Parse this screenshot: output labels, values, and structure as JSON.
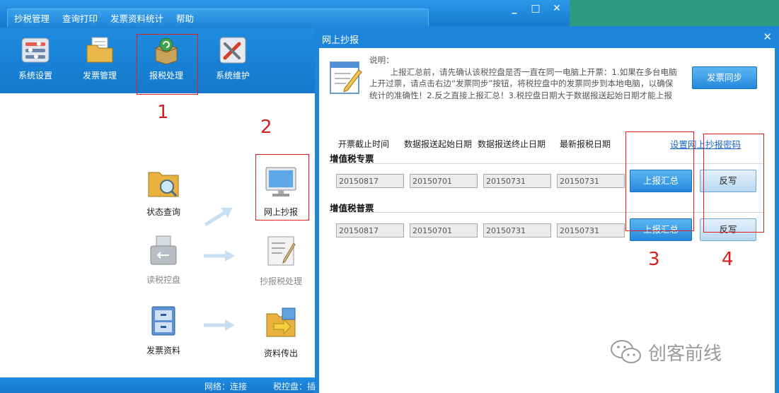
{
  "main_window": {
    "menu": [
      "抄税管理",
      "查询打印",
      "发票资料统计",
      "帮助"
    ],
    "window_buttons": [
      "_",
      "□",
      "✕"
    ],
    "toolbar": [
      {
        "label": "系统设置",
        "icon": "settings-panel-icon"
      },
      {
        "label": "发票管理",
        "icon": "invoice-folder-icon"
      },
      {
        "label": "报税处理",
        "icon": "tax-process-icon"
      },
      {
        "label": "系统维护",
        "icon": "maintenance-tools-icon"
      }
    ],
    "nodes": {
      "status_query": "状态查询",
      "online_copy": "网上抄报",
      "read_disk": "读税控盘",
      "copy_process": "抄报税处理",
      "invoice_data": "发票资料",
      "data_export": "资料传出"
    },
    "status": {
      "network": "网络：连接",
      "tax_disk": "税控盘：插"
    }
  },
  "annotations": {
    "n1": "1",
    "n2": "2",
    "n3": "3",
    "n4": "4"
  },
  "dialog": {
    "title": "网上抄报",
    "close": "✕",
    "desc_lines": [
      "说明：",
      "        上报汇总前，请先确认该税控盘是否一直在同一电脑上开票：1.如果在多台电脑",
      "上开过票，请点击右边“发票同步”按钮，将税控盘中的发票同步到本地电脑，以确保",
      "统计的准确性！2.反之直接上报汇总！3.税控盘日期大于数据报送起始日期才能上报"
    ],
    "sync_button": "发票同步",
    "columns": [
      "开票截止时间",
      "数据报送起始日期",
      "数据报送终止日期",
      "最新报税日期"
    ],
    "password_link": "设置网上抄报密码",
    "sections": [
      {
        "title": "增值税专票",
        "values": [
          "20150817",
          "20150701",
          "20150731",
          "20150731"
        ],
        "report_button": "上报汇总",
        "writeback_button": "反写"
      },
      {
        "title": "增值税普票",
        "values": [
          "20150817",
          "20150701",
          "20150731",
          "20150731"
        ],
        "report_button": "上报汇总",
        "writeback_button": "反写"
      }
    ]
  },
  "watermark": "创客前线",
  "colors": {
    "window_blue": "#1a84d8",
    "annotation_red": "#e02020",
    "link_blue": "#1b67c8"
  }
}
